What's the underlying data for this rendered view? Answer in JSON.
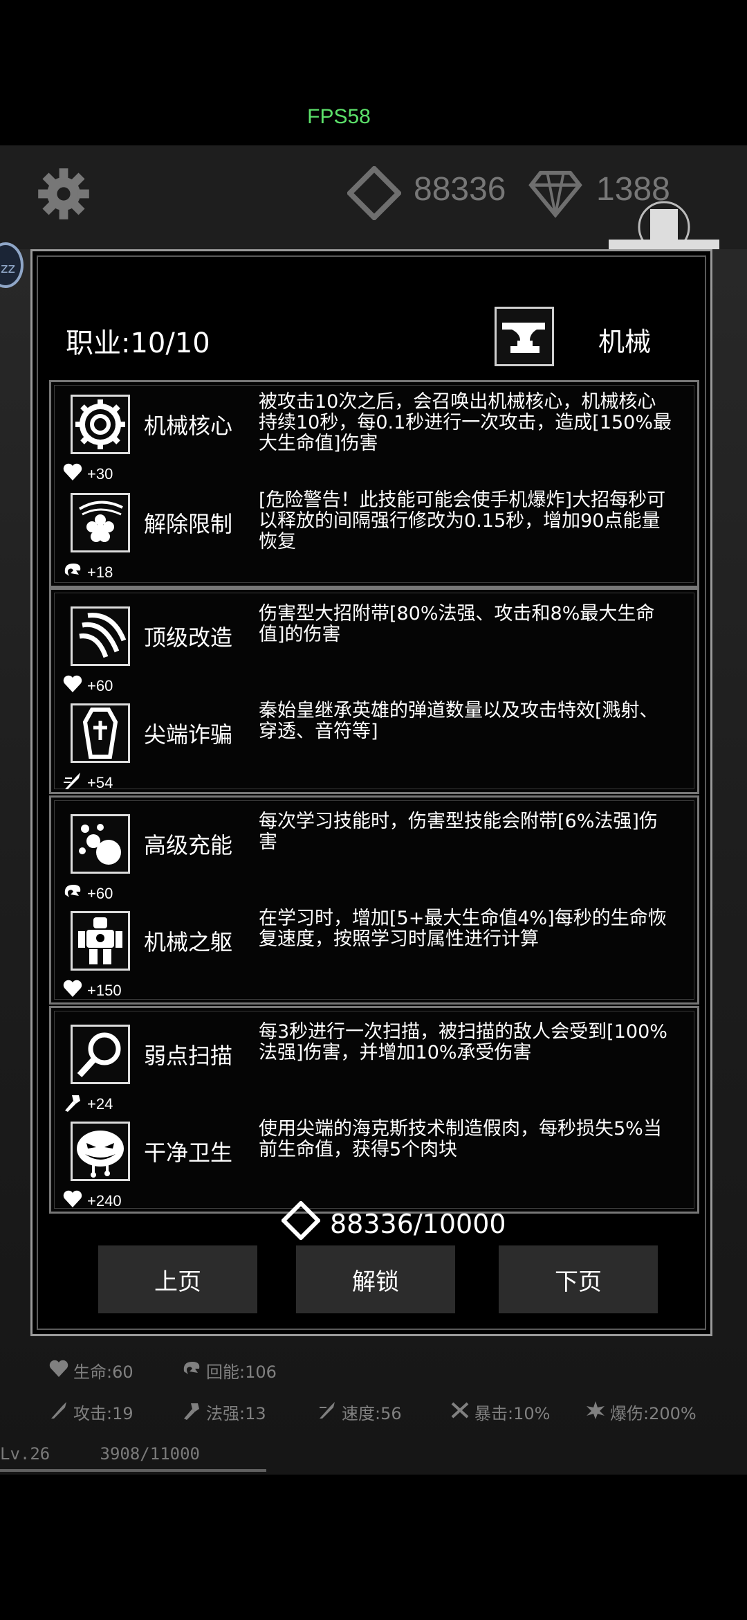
{
  "fps": "FPS58",
  "header": {
    "coins": "88336",
    "gems": "1388"
  },
  "modal": {
    "job_label": "职业:10/10",
    "class_name": "机械",
    "groups": [
      {
        "skills": [
          {
            "name": "机械核心",
            "desc": "被攻击10次之后，会召唤出机械核心，机械核心持续10秒，每0.1秒进行一次攻击，造成[150%最大生命值]伤害",
            "stat_icon": "heart-icon",
            "stat": "+30"
          },
          {
            "name": "解除限制",
            "desc": "[危险警告！此技能可能会使手机爆炸]大招每秒可以释放的间隔强行修改为0.15秒，增加90点能量恢复",
            "stat_icon": "regen-icon",
            "stat": "+18"
          }
        ]
      },
      {
        "skills": [
          {
            "name": "顶级改造",
            "desc": "伤害型大招附带[80%法强、攻击和8%最大生命值]的伤害",
            "stat_icon": "heart-icon",
            "stat": "+60"
          },
          {
            "name": "尖端诈骗",
            "desc": "秦始皇继承英雄的弹道数量以及攻击特效[溅射、穿透、音符等]",
            "stat_icon": "speed-icon",
            "stat": "+54"
          }
        ]
      },
      {
        "skills": [
          {
            "name": "高级充能",
            "desc": "每次学习技能时，伤害型技能会附带[6%法强]伤害",
            "stat_icon": "regen-icon",
            "stat": "+60"
          },
          {
            "name": "机械之躯",
            "desc": "在学习时，增加[5+最大生命值4%]每秒的生命恢复速度，按照学习时属性进行计算",
            "stat_icon": "heart-icon",
            "stat": "+150"
          }
        ]
      },
      {
        "skills": [
          {
            "name": "弱点扫描",
            "desc": "每3秒进行一次扫描，被扫描的敌人会受到[100%法强]伤害，并增加10%承受伤害",
            "stat_icon": "magic-icon",
            "stat": "+24"
          },
          {
            "name": "干净卫生",
            "desc": "使用尖端的海克斯技术制造假肉，每秒损失5%当前生命值，获得5个肉块",
            "stat_icon": "heart-icon",
            "stat": "+240"
          }
        ]
      }
    ],
    "cost": "88336/10000",
    "buttons": {
      "prev": "上页",
      "unlock": "解锁",
      "next": "下页"
    }
  },
  "player_stats": {
    "hp": "生命:60",
    "regen": "回能:106",
    "atk": "攻击:19",
    "magic": "法强:13",
    "speed": "速度:56",
    "crit": "暴击:10%",
    "crit_dmg": "爆伤:200%"
  },
  "level": {
    "lv": "Lv.26",
    "xp": "3908/11000",
    "xp_progress": 0.355
  }
}
